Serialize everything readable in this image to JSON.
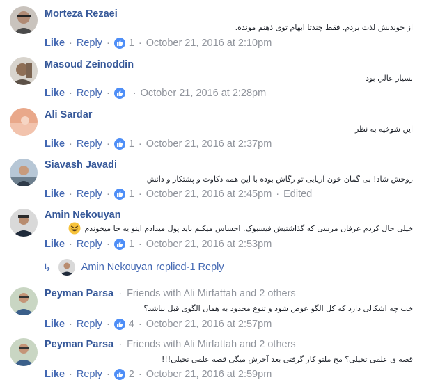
{
  "comments": [
    {
      "name": "Morteza Rezaei",
      "text": "از خوندنش لذت بردم. فقط چندتا ابهام توی ذهنم مونده.",
      "like": "Like",
      "reply": "Reply",
      "reactions": "1",
      "time": "October 21, 2016 at 2:10pm"
    },
    {
      "name": "Masoud Zeinoddin",
      "text": "بسيار عالي بود",
      "like": "Like",
      "reply": "Reply",
      "reactions": "",
      "time": "October 21, 2016 at 2:28pm"
    },
    {
      "name": "Ali Sardar",
      "text": "این شوخیه به نظر",
      "like": "Like",
      "reply": "Reply",
      "reactions": "1",
      "time": "October 21, 2016 at 2:37pm"
    },
    {
      "name": "Siavash Javadi",
      "text": "روحش شاد! بی گمان خون آریایی تو رگاش بوده با این همه ذکاوت و پشتکار و دانش",
      "like": "Like",
      "reply": "Reply",
      "reactions": "1",
      "time": "October 21, 2016 at 2:45pm",
      "edited": "Edited"
    },
    {
      "name": "Amin Nekouyan",
      "text": "خیلی حال کردم عرفان مرسی که گذاشتیش فیسبوک. احساس میکنم باید پول میدادم اینو یه جا میخوندم",
      "like": "Like",
      "reply": "Reply",
      "reactions": "1",
      "time": "October 21, 2016 at 2:53pm"
    },
    {
      "name": "Peyman Parsa",
      "friends": "Friends with Ali Mirfattah and 2 others",
      "text_line1": "خب چه اشکالی دارد که کل الگو عوض شود و تنوع محدود به همان الگوی قبل نباشد؟",
      "like": "Like",
      "reply": "Reply",
      "reactions": "4",
      "time": "October 21, 2016 at 2:57pm"
    },
    {
      "name": "Peyman Parsa",
      "friends": "Friends with Ali Mirfattah and 2 others",
      "text_line1": "قصه ی علمی تخیلی؟ مخ ملتو کار گرفتی بعد آخرش میگی قصه علمی تخیلی!!!",
      "like": "Like",
      "reply": "Reply",
      "reactions": "2",
      "time": "October 21, 2016 at 2:59pm"
    }
  ],
  "replied": {
    "name": "Amin Nekouyan",
    "action": "replied",
    "count": "1 Reply"
  },
  "separator": "·",
  "colors": {
    "link": "#4267b2",
    "name": "#365899",
    "meta": "#90949c",
    "text": "#1d2129",
    "like_icon": "#4e8ef7"
  }
}
